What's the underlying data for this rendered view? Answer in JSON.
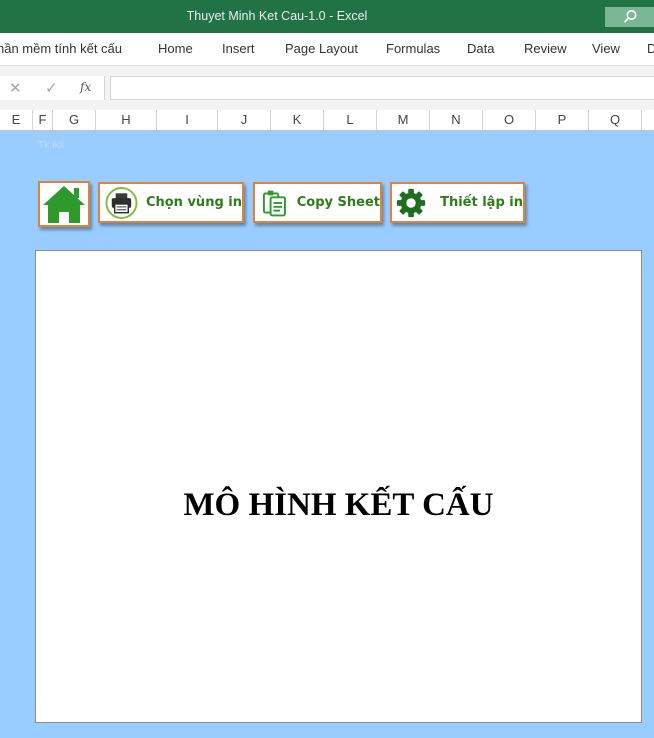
{
  "titlebar": {
    "title": "Thuyet Minh Ket Cau-1.0  -  Excel"
  },
  "ribbon": {
    "tabs": [
      "hần mềm tính kết cấu",
      "Home",
      "Insert",
      "Page Layout",
      "Formulas",
      "Data",
      "Review",
      "View",
      "D"
    ]
  },
  "formula_bar": {
    "fx": "fx",
    "value": ""
  },
  "columns": [
    "E",
    "F",
    "G",
    "H",
    "I",
    "J",
    "K",
    "L",
    "M",
    "N",
    "O",
    "P",
    "Q"
  ],
  "faint_text": "Tk Ikli",
  "toolbar": {
    "select_area_label": "Chọn vùng in",
    "copy_sheet_label": "Copy Sheet",
    "print_setup_label": "Thiết lập in"
  },
  "canvas": {
    "heading": "MÔ HÌNH KẾT CẤU"
  },
  "colors": {
    "title_bar": "#217346",
    "sheet_background": "#99CCFF",
    "button_border": "#E0823A",
    "button_text": "#2E7D1A",
    "icon_green": "#2E9A2E"
  }
}
